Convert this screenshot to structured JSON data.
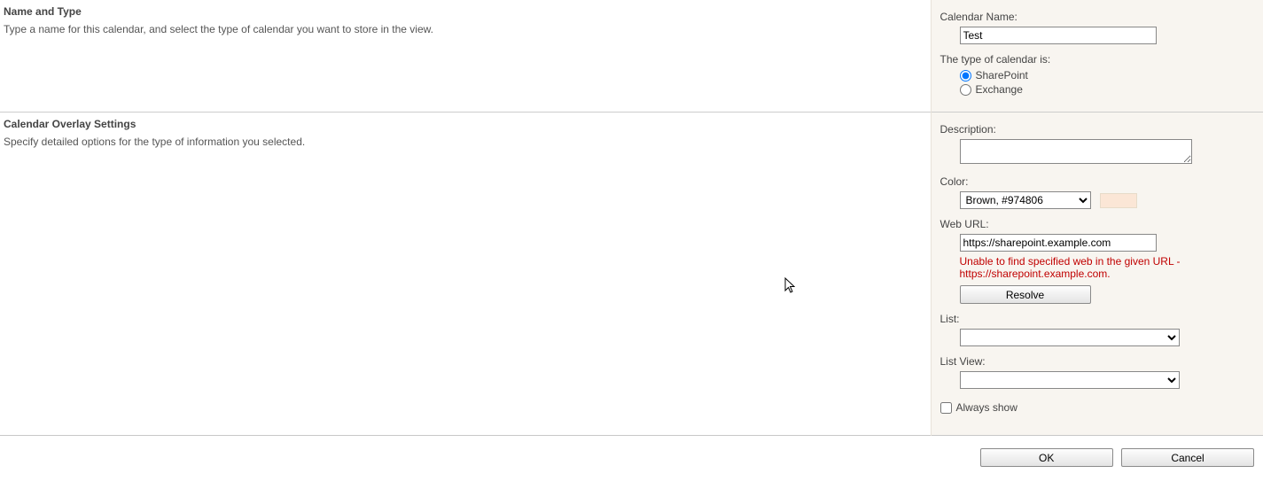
{
  "section1": {
    "heading": "Name and Type",
    "description": "Type a name for this calendar, and select the type of calendar you want to store in the view.",
    "calendar_name_label": "Calendar Name:",
    "calendar_name_value": "Test",
    "type_label": "The type of calendar is:",
    "radio_sharepoint": "SharePoint",
    "radio_exchange": "Exchange"
  },
  "section2": {
    "heading": "Calendar Overlay Settings",
    "description": "Specify detailed options for the type of information you selected.",
    "description_label": "Description:",
    "description_value": "",
    "color_label": "Color:",
    "color_value": "Brown, #974806",
    "swatch_color": "#fbe6d6",
    "weburl_label": "Web URL:",
    "weburl_value": "https://sharepoint.example.com",
    "weburl_error": "Unable to find specified web in the given URL - https://sharepoint.example.com.",
    "resolve_label": "Resolve",
    "list_label": "List:",
    "list_value": "",
    "listview_label": "List View:",
    "listview_value": "",
    "always_show_label": "Always show"
  },
  "footer": {
    "ok": "OK",
    "cancel": "Cancel"
  }
}
